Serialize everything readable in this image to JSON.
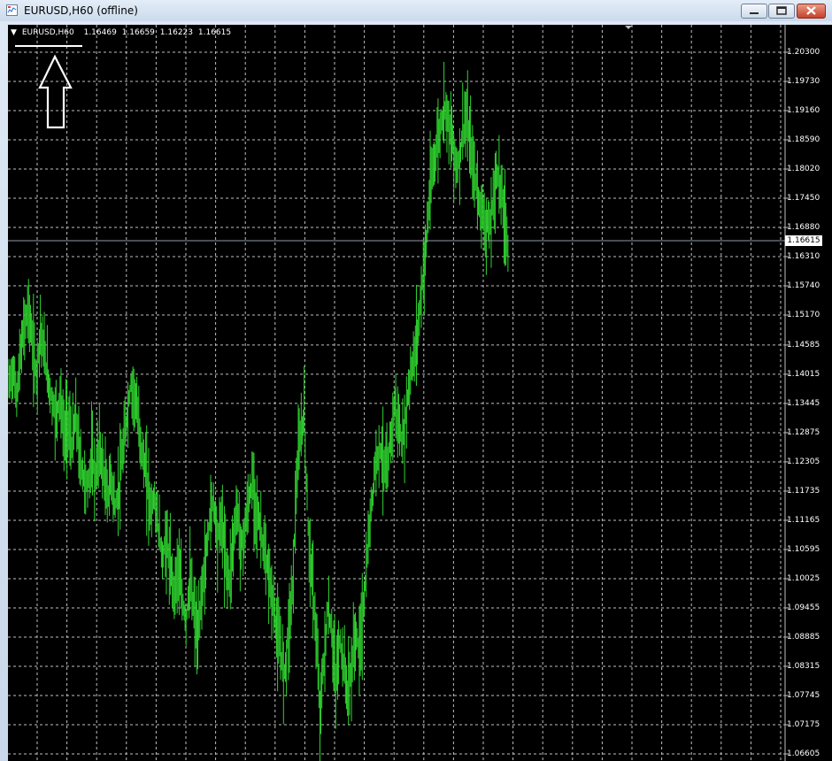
{
  "window": {
    "title": "EURUSD,H60 (offline)",
    "icon": "chart-window-icon",
    "buttons": [
      "minimize-icon",
      "restore-icon",
      "close-icon"
    ]
  },
  "chart": {
    "symbol": "EURUSD,H60",
    "ohlc": {
      "open": "1.16469",
      "high": "1.16659",
      "low": "1.16223",
      "close": "1.16615"
    },
    "current_price": "1.16615",
    "price_scale": [
      "1.20300",
      "1.19730",
      "1.19160",
      "1.18590",
      "1.18020",
      "1.17450",
      "1.16880",
      "1.16310",
      "1.15740",
      "1.15170",
      "1.14585",
      "1.14015",
      "1.13445",
      "1.12875",
      "1.12305",
      "1.11735",
      "1.11165",
      "1.10595",
      "1.10025",
      "1.09455",
      "1.08885",
      "1.08315",
      "1.07745",
      "1.07175",
      "1.06605"
    ],
    "colors": {
      "background": "#000000",
      "bars": "#2fd42f",
      "grid": "#bfbfbf",
      "annotation": "#ffffff"
    },
    "annotations": [
      "underline-mark",
      "up-arrow-icon"
    ]
  },
  "chart_data": {
    "type": "line",
    "title": "EURUSD,H60",
    "xlabel": "",
    "ylabel": "",
    "ylim": [
      1.06605,
      1.203
    ],
    "grid": true,
    "series": [
      {
        "values": [
          1.138,
          1.141,
          1.136,
          1.144,
          1.15,
          1.153,
          1.146,
          1.14,
          1.149,
          1.144,
          1.139,
          1.135,
          1.132,
          1.136,
          1.128,
          1.131,
          1.126,
          1.132,
          1.124,
          1.12,
          1.118,
          1.124,
          1.12,
          1.126,
          1.121,
          1.116,
          1.12,
          1.114,
          1.118,
          1.125,
          1.132,
          1.138,
          1.136,
          1.13,
          1.124,
          1.12,
          1.114,
          1.116,
          1.11,
          1.104,
          1.108,
          1.102,
          1.098,
          1.103,
          1.096,
          1.092,
          1.1,
          1.094,
          1.088,
          1.098,
          1.104,
          1.112,
          1.116,
          1.108,
          1.112,
          1.104,
          1.1,
          1.108,
          1.114,
          1.106,
          1.11,
          1.116,
          1.119,
          1.113,
          1.11,
          1.104,
          1.101,
          1.096,
          1.09,
          1.086,
          1.082,
          1.09,
          1.098,
          1.118,
          1.128,
          1.132,
          1.11,
          1.1,
          1.09,
          1.074,
          1.084,
          1.094,
          1.09,
          1.08,
          1.088,
          1.084,
          1.078,
          1.082,
          1.09,
          1.086,
          1.094,
          1.104,
          1.114,
          1.122,
          1.126,
          1.124,
          1.12,
          1.128,
          1.134,
          1.13,
          1.126,
          1.134,
          1.14,
          1.144,
          1.15,
          1.158,
          1.166,
          1.176,
          1.182,
          1.186,
          1.19,
          1.193,
          1.188,
          1.184,
          1.18,
          1.186,
          1.19,
          1.186,
          1.18,
          1.176,
          1.172,
          1.17,
          1.168,
          1.174,
          1.18,
          1.176,
          1.17,
          1.164
        ]
      }
    ]
  }
}
